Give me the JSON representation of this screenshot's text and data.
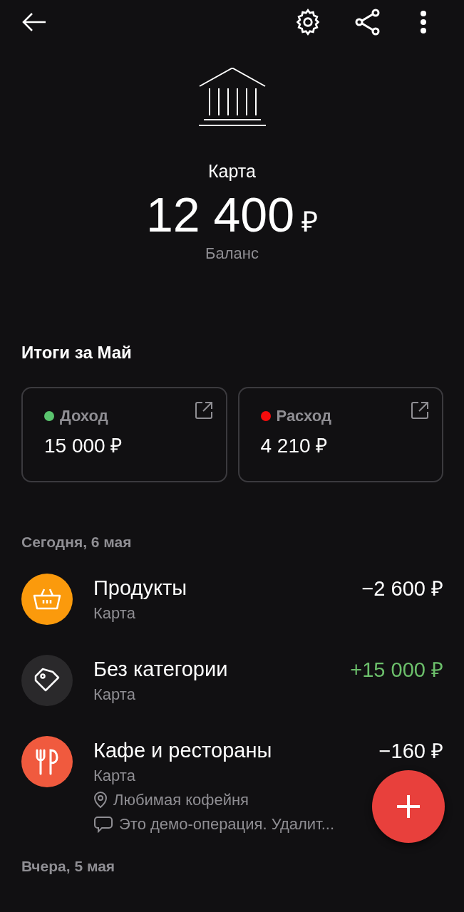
{
  "account": {
    "name": "Карта",
    "balance": "12 400",
    "currency": "₽",
    "balance_label": "Баланс"
  },
  "summary": {
    "title": "Итоги за Май",
    "cards": [
      {
        "label": "Доход",
        "amount": "15 000 ₽",
        "color": "#5ac46e"
      },
      {
        "label": "Расход",
        "amount": "4 210 ₽",
        "color": "#f50c0c"
      }
    ]
  },
  "days": [
    {
      "title": "Сегодня, 6 мая",
      "transactions": [
        {
          "kind": "basket",
          "color": "#fb9a0c",
          "category": "Продукты",
          "account": "Карта",
          "amount": "−2 600 ₽",
          "income": false
        },
        {
          "kind": "tag",
          "color": "#2a292b",
          "category": "Без категории",
          "account": "Карта",
          "amount": "+15 000 ₽",
          "income": true
        },
        {
          "kind": "cutlery",
          "color": "#f05a3e",
          "category": "Кафе и рестораны",
          "account": "Карта",
          "amount": "−160 ₽",
          "income": false,
          "place": "Любимая кофейня",
          "note": "Это демо-операция. Удалит..."
        }
      ]
    },
    {
      "title": "Вчера, 5 мая"
    }
  ]
}
